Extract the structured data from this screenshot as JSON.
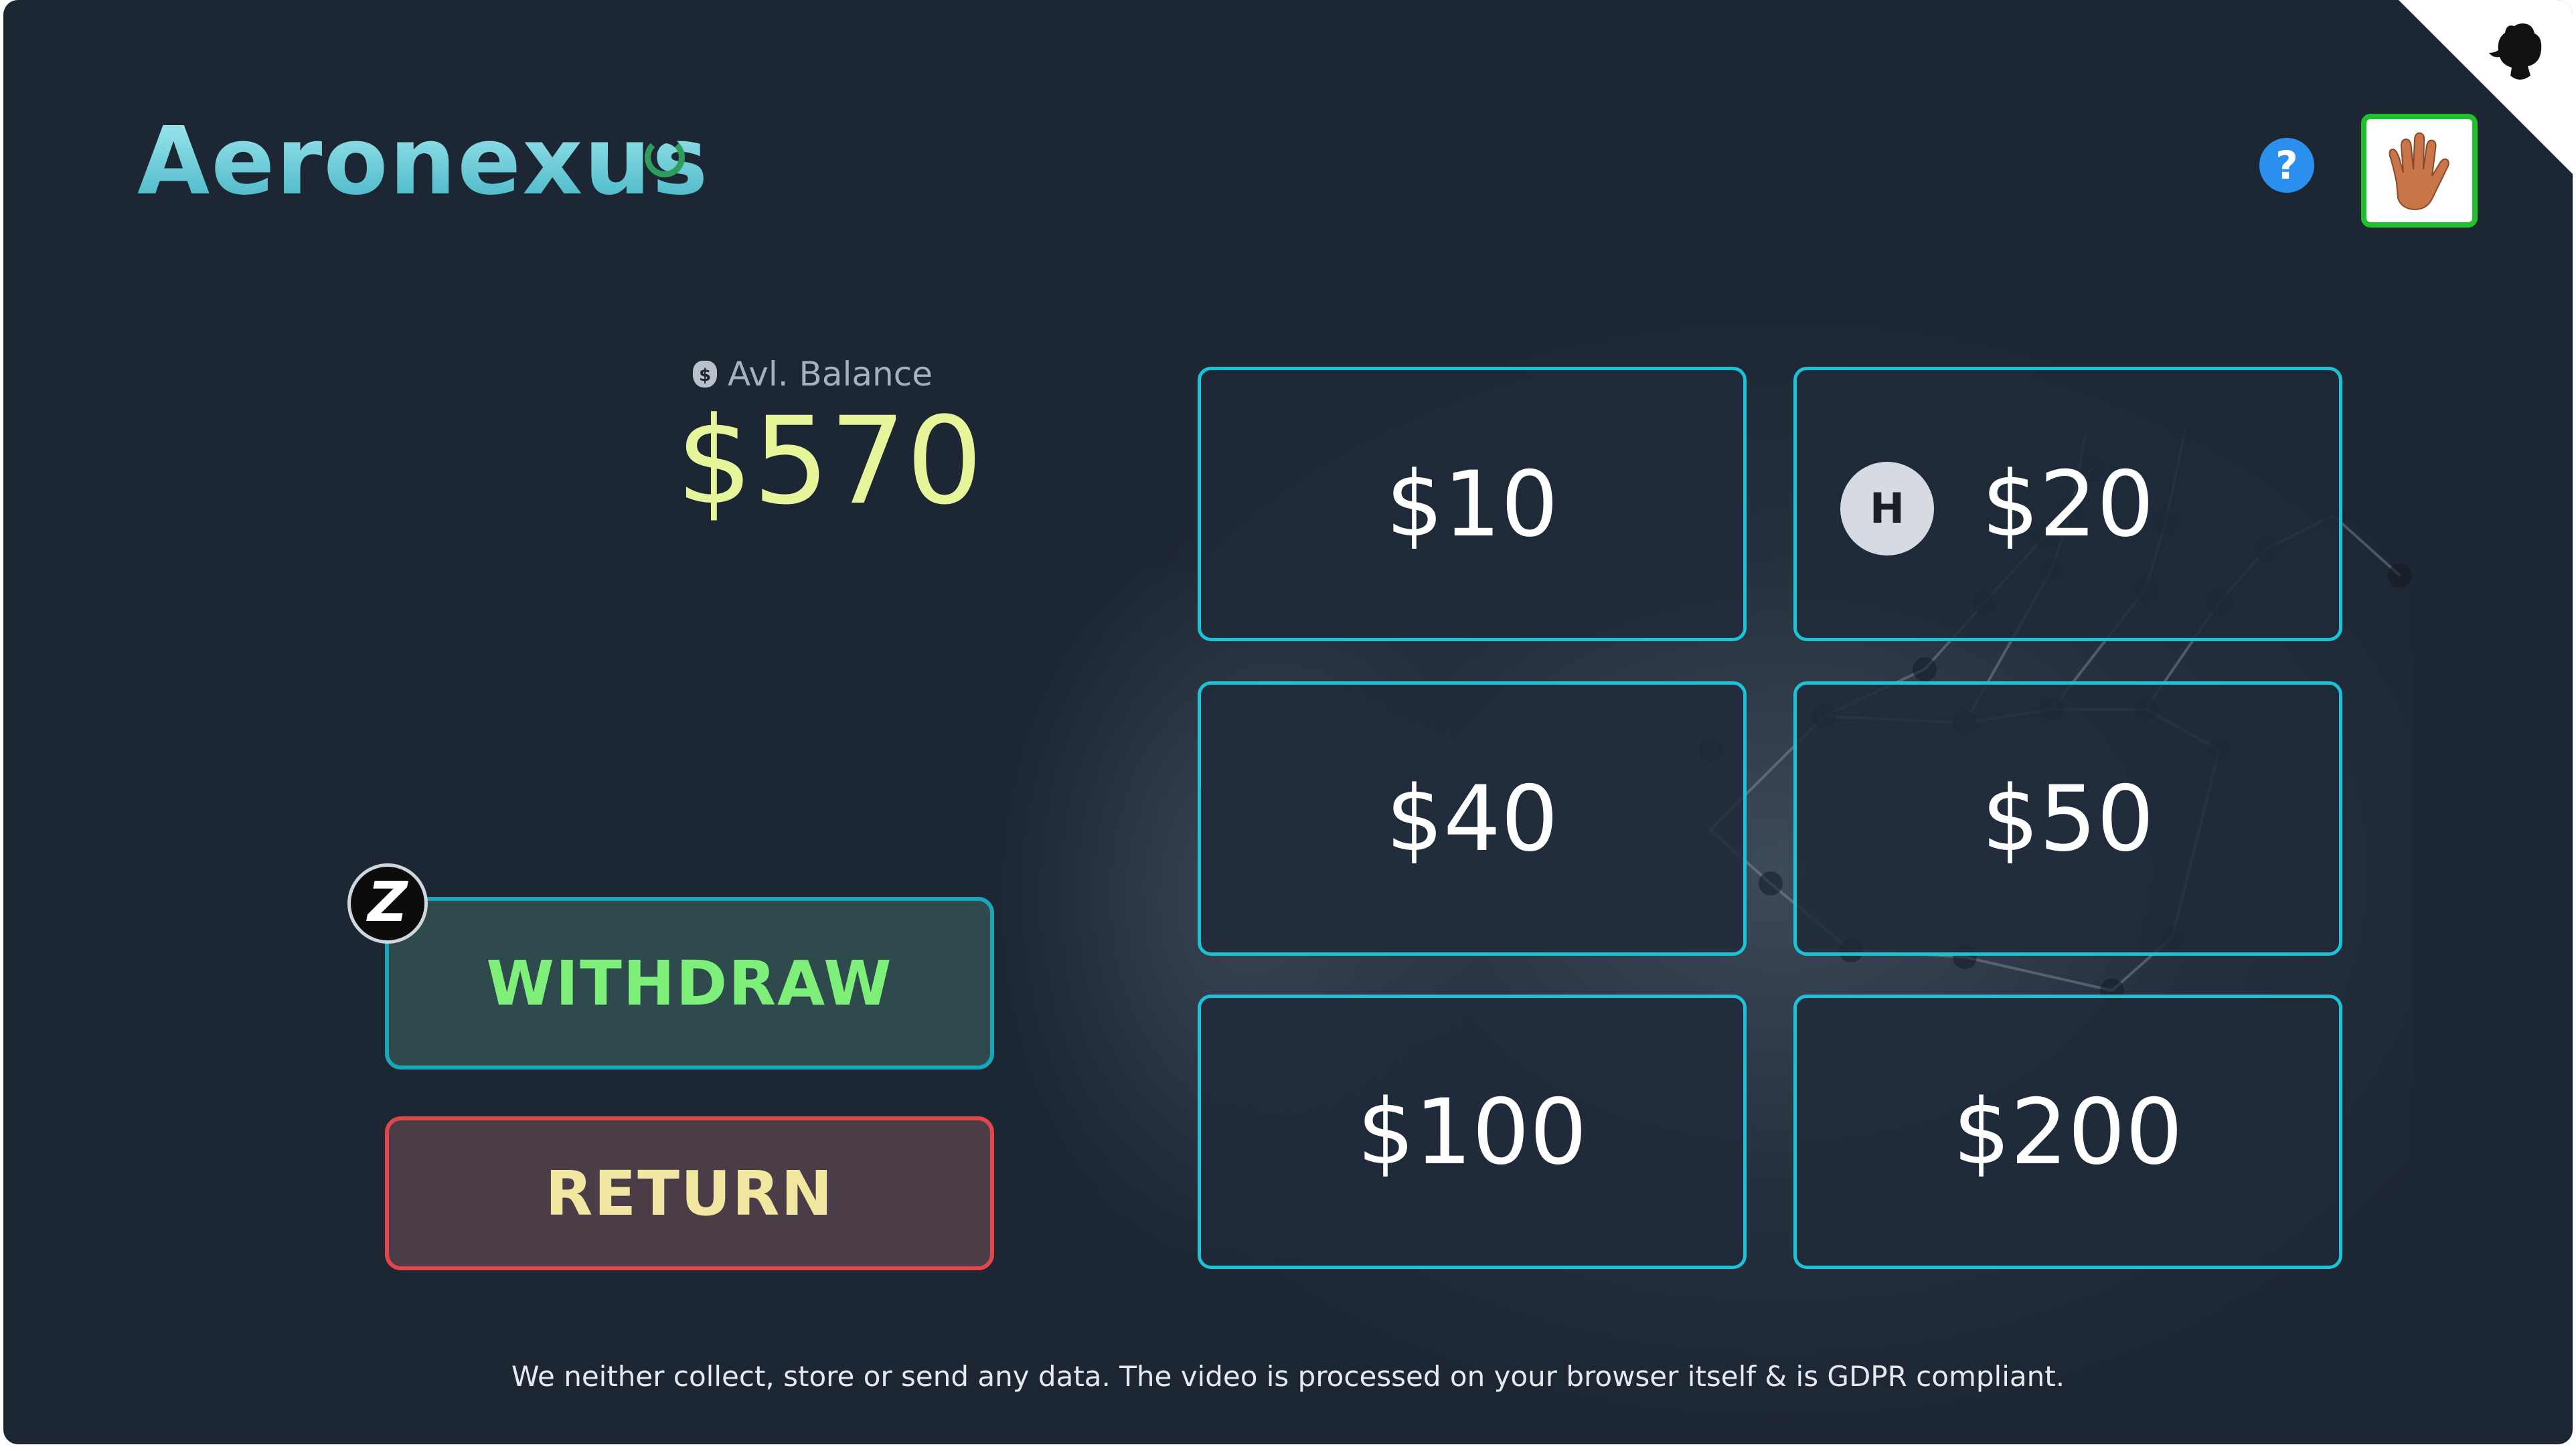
{
  "header": {
    "logo_text": "Aeronexus",
    "help_label": "?"
  },
  "balance": {
    "label": "Avl. Balance",
    "bag_symbol": "$",
    "value": "$570"
  },
  "actions": {
    "withdraw_label": "WITHDRAW",
    "return_label": "RETURN",
    "badge_letter": "Z"
  },
  "amounts": [
    {
      "label": "$10"
    },
    {
      "label": "$20"
    },
    {
      "label": "$40"
    },
    {
      "label": "$50"
    },
    {
      "label": "$100"
    },
    {
      "label": "$200"
    }
  ],
  "hover_badge": "H",
  "footer_text": "We neither collect, store or send any data. The video is processed on your browser itself & is GDPR compliant.",
  "colors": {
    "background": "#1d2633",
    "accent_cyan": "#1cc3d6",
    "balance": "#e6f59a",
    "withdraw_text": "#7ef07a",
    "return_border": "#e0464a",
    "return_text": "#f2e7a0",
    "help_blue": "#2b8ff0",
    "avatar_border": "#22c02d"
  },
  "icons": {
    "loading": "spinner-icon",
    "help": "help-icon",
    "avatar": "hand-avatar-icon",
    "corner": "github-corner-icon",
    "money_bag": "money-bag-icon",
    "brand_badge": "z-logo-icon"
  }
}
